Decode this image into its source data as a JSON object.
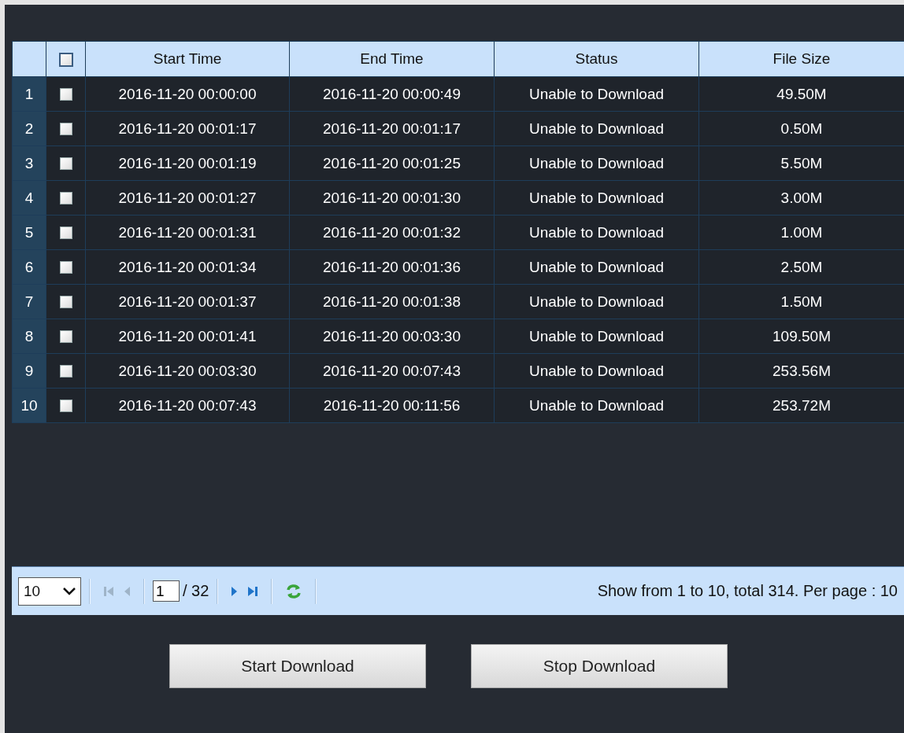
{
  "table": {
    "select_all": {
      "checked": false
    },
    "columns": [
      "Start Time",
      "End Time",
      "Status",
      "File Size"
    ],
    "rows": [
      {
        "index": "1",
        "checked": false,
        "start_time": "2016-11-20 00:00:00",
        "end_time": "2016-11-20 00:00:49",
        "status": "Unable to Download",
        "file_size": "49.50M"
      },
      {
        "index": "2",
        "checked": false,
        "start_time": "2016-11-20 00:01:17",
        "end_time": "2016-11-20 00:01:17",
        "status": "Unable to Download",
        "file_size": "0.50M"
      },
      {
        "index": "3",
        "checked": false,
        "start_time": "2016-11-20 00:01:19",
        "end_time": "2016-11-20 00:01:25",
        "status": "Unable to Download",
        "file_size": "5.50M"
      },
      {
        "index": "4",
        "checked": false,
        "start_time": "2016-11-20 00:01:27",
        "end_time": "2016-11-20 00:01:30",
        "status": "Unable to Download",
        "file_size": "3.00M"
      },
      {
        "index": "5",
        "checked": false,
        "start_time": "2016-11-20 00:01:31",
        "end_time": "2016-11-20 00:01:32",
        "status": "Unable to Download",
        "file_size": "1.00M"
      },
      {
        "index": "6",
        "checked": false,
        "start_time": "2016-11-20 00:01:34",
        "end_time": "2016-11-20 00:01:36",
        "status": "Unable to Download",
        "file_size": "2.50M"
      },
      {
        "index": "7",
        "checked": false,
        "start_time": "2016-11-20 00:01:37",
        "end_time": "2016-11-20 00:01:38",
        "status": "Unable to Download",
        "file_size": "1.50M"
      },
      {
        "index": "8",
        "checked": false,
        "start_time": "2016-11-20 00:01:41",
        "end_time": "2016-11-20 00:03:30",
        "status": "Unable to Download",
        "file_size": "109.50M"
      },
      {
        "index": "9",
        "checked": false,
        "start_time": "2016-11-20 00:03:30",
        "end_time": "2016-11-20 00:07:43",
        "status": "Unable to Download",
        "file_size": "253.56M"
      },
      {
        "index": "10",
        "checked": false,
        "start_time": "2016-11-20 00:07:43",
        "end_time": "2016-11-20 00:11:56",
        "status": "Unable to Download",
        "file_size": "253.72M"
      }
    ]
  },
  "pager": {
    "page_size": "10",
    "nav_back": [
      {
        "kind": "first",
        "disabled": true
      },
      {
        "kind": "prev",
        "disabled": true
      }
    ],
    "page": "1",
    "page_total": "/ 32",
    "nav_forward": [
      {
        "kind": "next",
        "disabled": false
      },
      {
        "kind": "last",
        "disabled": false
      }
    ],
    "summary": "Show from 1 to 10, total 314. Per page : 10"
  },
  "buttons": [
    "Start Download",
    "Stop Download"
  ]
}
